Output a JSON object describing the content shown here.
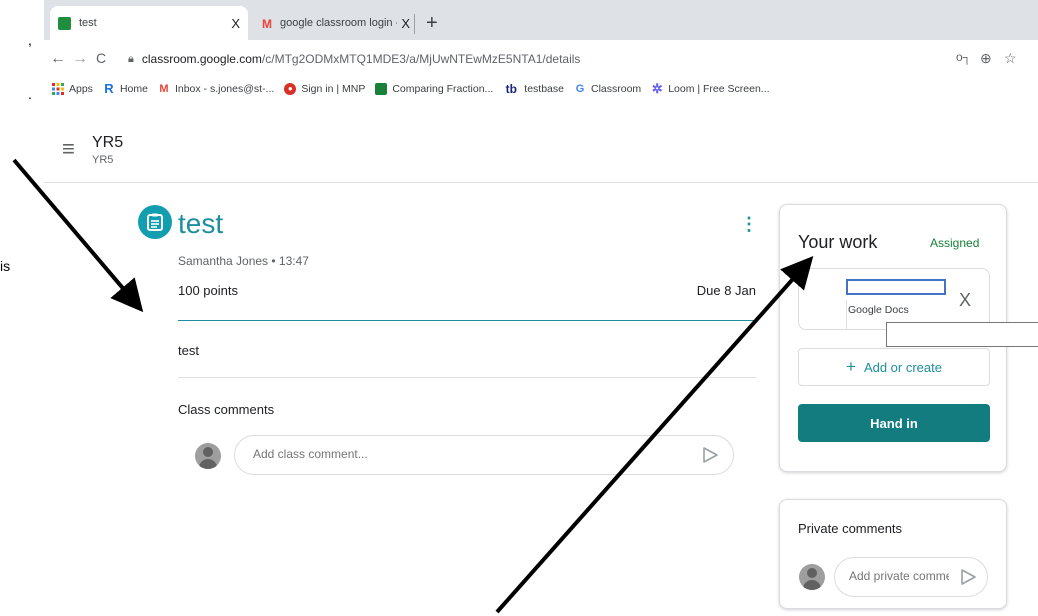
{
  "margin_text": [
    ",",
    ".",
    "is"
  ],
  "browser": {
    "tabs": [
      {
        "title": "test",
        "close": "X",
        "favicon_color": "#1e8e3e"
      },
      {
        "title": "google classroom login - s.jones",
        "close": "X",
        "favicon_color": "#ea4335"
      }
    ],
    "new_tab": "+",
    "minimize": "–",
    "url_host": "classroom.google.com",
    "url_path": "/c/MTg2ODMxMTQ1MDE3/a/MjUwNTEwMzE5NTA1/details",
    "nav": {
      "back": "←",
      "forward": "→",
      "reload": "C"
    },
    "bookmarks": [
      {
        "label": "Apps",
        "icon": "apps-grid-icon",
        "color": "#d93025"
      },
      {
        "label": "Home",
        "icon": "r-icon",
        "color": "#1a73e8"
      },
      {
        "label": "Inbox - s.jones@st-...",
        "icon": "gmail-icon",
        "color": "#ea4335"
      },
      {
        "label": "Sign in | MNP",
        "icon": "mnp-icon",
        "color": "#d93025"
      },
      {
        "label": "Comparing Fraction...",
        "icon": "fraction-icon",
        "color": "#188038"
      },
      {
        "label": "testbase",
        "icon": "tb-icon",
        "color": "#1a237e"
      },
      {
        "label": "Classroom",
        "icon": "google-icon",
        "color": "#4285f4"
      },
      {
        "label": "Loom | Free Screen...",
        "icon": "loom-icon",
        "color": "#625df5"
      }
    ]
  },
  "header": {
    "class_name": "YR5",
    "class_sub": "YR5"
  },
  "assignment": {
    "title": "test",
    "author_time": "Samantha Jones • 13:47",
    "points": "100 points",
    "due": "Due 8 Jan",
    "body": "test",
    "class_comments_title": "Class comments",
    "class_comment_placeholder": "Add class comment..."
  },
  "your_work": {
    "title": "Your work",
    "status": "Assigned",
    "attachment_label": "Google Docs",
    "attachment_remove": "X",
    "add_or_create": "Add or create",
    "hand_in": "Hand in"
  },
  "private_comments": {
    "title": "Private comments",
    "placeholder": "Add private comment..."
  },
  "colors": {
    "accent": "#1e8e9e",
    "hand_in": "#127c7f",
    "assigned": "#188038"
  }
}
